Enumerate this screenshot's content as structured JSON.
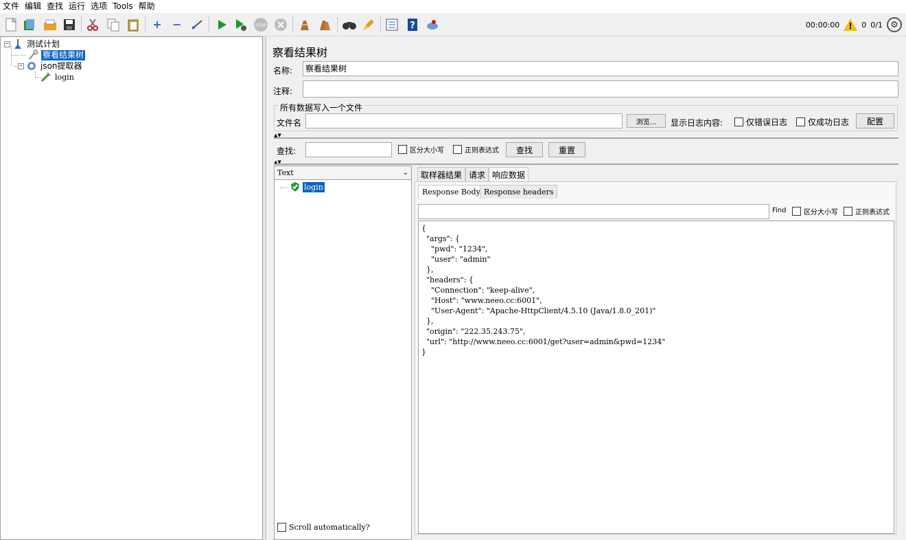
{
  "menu": [
    "文件",
    "编辑",
    "查找",
    "运行",
    "选项",
    "Tools",
    "帮助"
  ],
  "status": {
    "timer": "00:00:00",
    "warnings": "0",
    "threads": "0/1"
  },
  "tree": {
    "root": "测试计划",
    "result_tree": "察看结果树",
    "extractor": "json提取器",
    "sampler": "login"
  },
  "panel": {
    "title": "察看结果树",
    "name_label": "名称:",
    "name_value": "察看结果树",
    "comment_label": "注释:",
    "comment_value": "",
    "file_group_title": "所有数据写入一个文件",
    "filename_label": "文件名",
    "filename_value": "",
    "browse_button": "浏览...",
    "log_label": "显示日志内容:",
    "errors_only": "仅错误日志",
    "success_only": "仅成功日志",
    "config_button": "配置"
  },
  "search": {
    "label": "查找:",
    "value": "",
    "case_sensitive": "区分大小写",
    "regex": "正则表达式",
    "find_button": "查找",
    "reset_button": "重置"
  },
  "results": {
    "renderer": "Text",
    "items": [
      "login"
    ],
    "scroll_auto": "Scroll automatically?"
  },
  "tabs": [
    "取样器结果",
    "请求",
    "响应数据"
  ],
  "subtabs": [
    "Response Body",
    "Response headers"
  ],
  "response_find": {
    "value": "",
    "label": "Find",
    "case_sensitive": "区分大小写",
    "regex": "正则表达式"
  },
  "response_body": [
    "{",
    "  \"args\": {",
    "    \"pwd\": \"1234\",",
    "    \"user\": \"admin\"",
    "  },",
    "  \"headers\": {",
    "    \"Connection\": \"keep-alive\",",
    "    \"Host\": \"www.neeo.cc:6001\",",
    "    \"User-Agent\": \"Apache-HttpClient/4.5.10 (Java/1.8.0_201)\"",
    "  },",
    "  \"origin\": \"222.35.243.75\",",
    "  \"url\": \"http://www.neeo.cc:6001/get?user=admin&pwd=1234\"",
    "}"
  ]
}
